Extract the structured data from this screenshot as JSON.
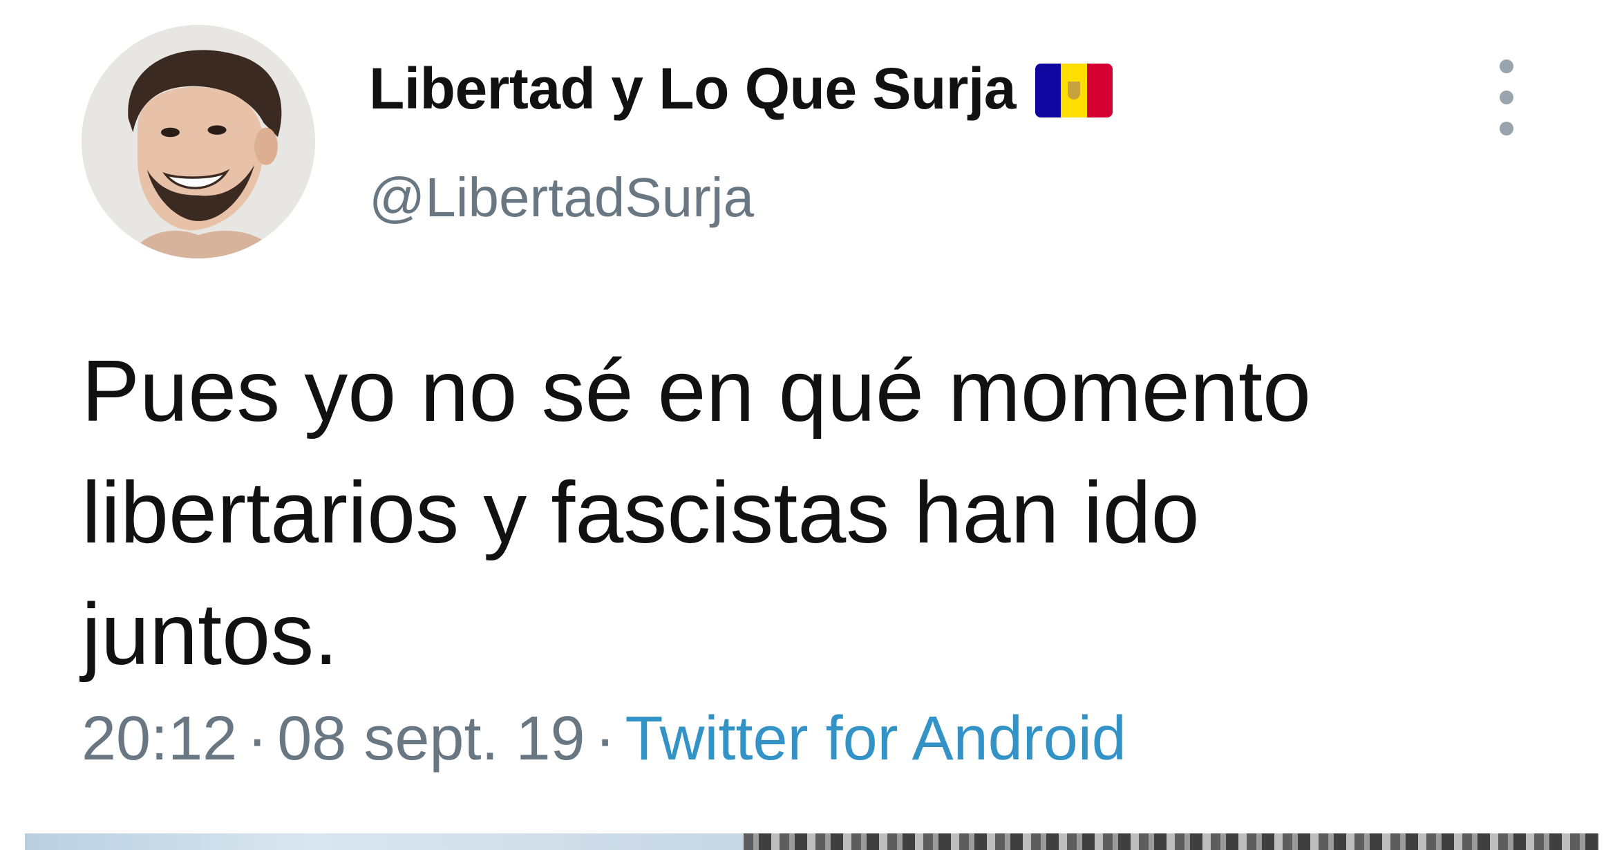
{
  "tweet": {
    "author": {
      "display_name": "Libertad y Lo Que Surja",
      "handle": "@LibertadSurja",
      "flag_icon": "andorra-flag-icon"
    },
    "text": "Pues yo no sé en qué momento\nlibertarios y fascistas han ido\njuntos.",
    "time": "20:12",
    "date": "08 sept. 19",
    "separator": "·",
    "source": "Twitter for Android",
    "more_icon": "more-vertical-icon"
  },
  "colors": {
    "text": "#111111",
    "secondary_text": "#697783",
    "link": "#3393c7",
    "background": "#ffffff"
  }
}
